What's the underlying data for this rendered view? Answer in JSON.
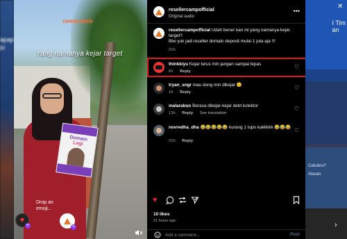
{
  "background": {
    "left_text": "apap\nju",
    "right_text_top": "I Tim\nan",
    "right_small_1": "Cekubru?",
    "right_small_2": "Alasan"
  },
  "video": {
    "logo_text": "cemaraweb",
    "caption": "Yang namanya kejar target",
    "book_title_1": "Domain",
    "book_title_2": "Lagi",
    "drop_emoji": "Drop an\nemoji...",
    "emoji_icon": "heart-emoji-icon"
  },
  "post": {
    "author": "resellercampofficial",
    "audio": "Original audio",
    "more_icon": "more-dots-icon"
  },
  "comments": [
    {
      "user": "resellercampofficial",
      "text": "Udah bener kan ini yang namanya kejar target?\nBtw yuk jadi reseller domain deposit mulai 1 juta aja !!!",
      "time": "21h",
      "reply": "",
      "translate": ""
    },
    {
      "user": "thinkkiyu",
      "text": "Kejar terus min jangan sampai lepas",
      "time": "6h",
      "reply": "Reply",
      "translate": ""
    },
    {
      "user": "tryan_sngr",
      "text": "mau dong min dikejar 😊",
      "time": "1h",
      "reply": "Reply",
      "translate": ""
    },
    {
      "user": "malarabun",
      "text": "Berasa dikejar-kejar debt kolektor",
      "time": "13h",
      "reply": "Reply",
      "translate": "See translation"
    },
    {
      "user": "novredha_dha",
      "text": "😂😂😂😂😂 kurang 1 tupo kakkkkk 😂😂😂",
      "time": "21h",
      "reply": "Reply",
      "translate": ""
    }
  ],
  "actions": {
    "likes": "10 likes",
    "ago": "21 hours ago"
  },
  "add_comment": {
    "placeholder": "Add a comment...",
    "post_label": "Post"
  },
  "colors": {
    "highlight": "#e01818",
    "heart_liked": "#ed1c3c",
    "panel_bg": "#000000"
  }
}
